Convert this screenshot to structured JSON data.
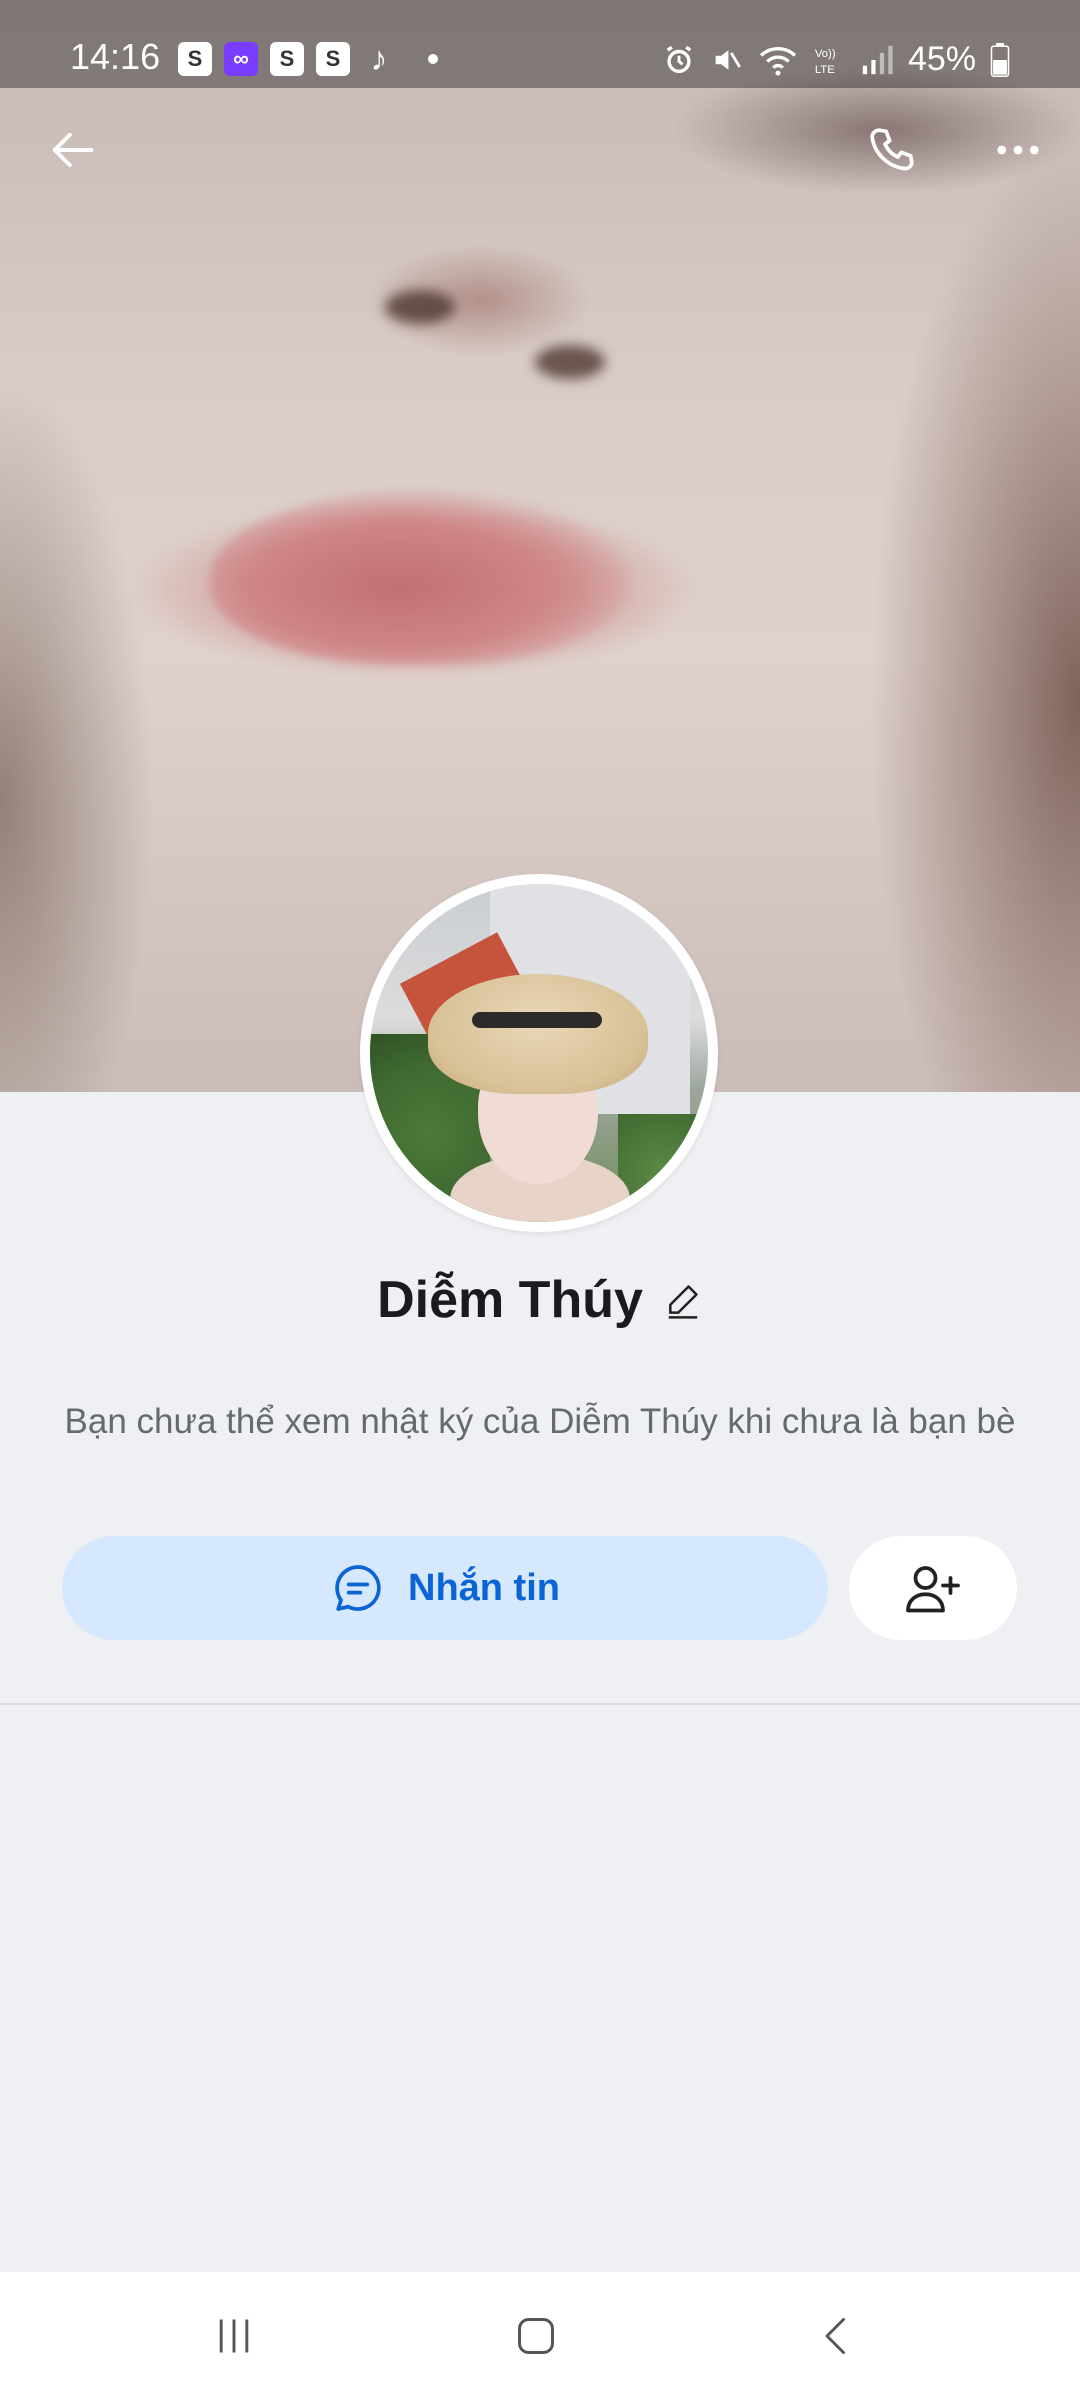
{
  "status_bar": {
    "time": "14:16",
    "battery": "45%",
    "notification_icons": [
      "shopee-icon",
      "infinity-app-icon",
      "shopee-icon",
      "shopee-icon",
      "tiktok-icon"
    ],
    "system_icons": [
      "alarm-icon",
      "mute-icon",
      "wifi-icon",
      "volte-icon",
      "signal-icon",
      "battery-icon"
    ]
  },
  "profile": {
    "name": "Diễm Thúy",
    "notice": "Bạn chưa thể xem nhật ký của Diễm Thúy khi chưa là bạn bè"
  },
  "actions": {
    "message_label": "Nhắn tin"
  },
  "colors": {
    "accent": "#0b64d6",
    "message_bg": "#d6e8fd",
    "page_bg": "#eff0f4"
  }
}
